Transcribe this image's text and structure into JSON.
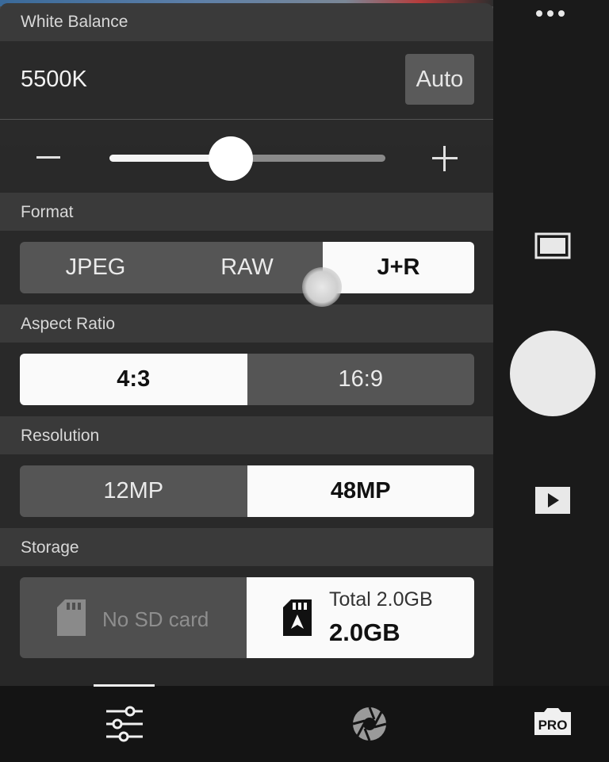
{
  "white_balance": {
    "title": "White Balance",
    "value": "5500K",
    "auto_label": "Auto",
    "minus_label": "−",
    "slider_fraction": 0.44
  },
  "format": {
    "title": "Format",
    "options": [
      "JPEG",
      "RAW",
      "J+R"
    ],
    "selected": "J+R"
  },
  "aspect_ratio": {
    "title": "Aspect Ratio",
    "options": [
      "4:3",
      "16:9"
    ],
    "selected": "4:3"
  },
  "resolution": {
    "title": "Resolution",
    "options": [
      "12MP",
      "48MP"
    ],
    "selected": "48MP"
  },
  "storage": {
    "title": "Storage",
    "sd_label": "No SD card",
    "internal_total": "Total 2.0GB",
    "internal_free": "2.0GB"
  },
  "bottom_tabs": [
    {
      "name": "settings-sliders-icon",
      "selected": true
    },
    {
      "name": "aperture-icon",
      "selected": false
    },
    {
      "name": "pro-mode-icon",
      "label": "PRO",
      "selected": false
    }
  ],
  "right_rail": {
    "icons": [
      "more-dots-icon",
      "aspect-ratio-icon",
      "shutter-button",
      "playback-icon"
    ]
  },
  "colors": {
    "panel_bg": "#282828",
    "selected_bg": "#fafafa",
    "unselected_bg": "#555555"
  }
}
